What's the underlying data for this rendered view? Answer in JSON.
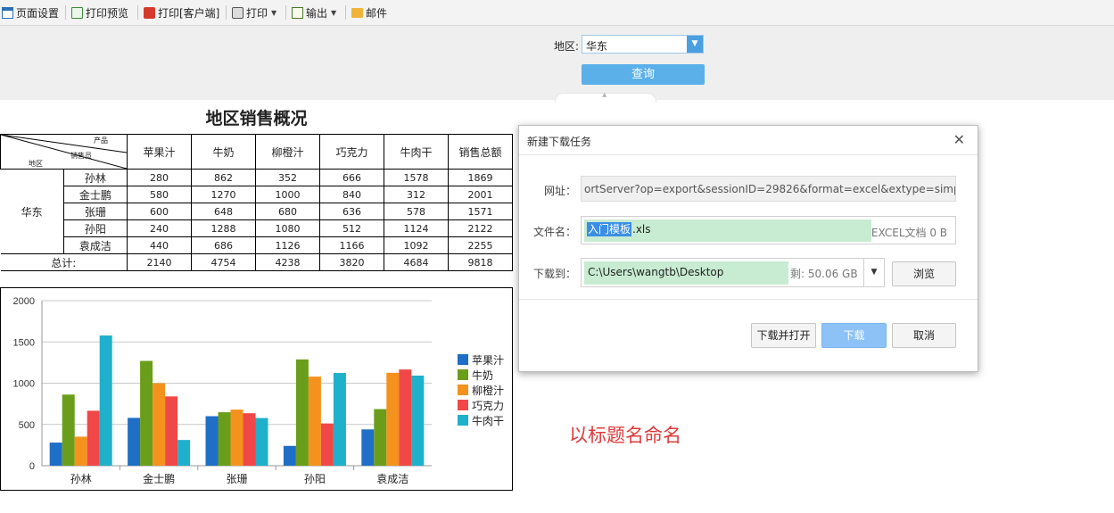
{
  "toolbar": {
    "page_setup": "页面设置",
    "print_preview": "打印预览",
    "print_client": "打印[客户端]",
    "print": "打印",
    "export": "输出",
    "mail": "邮件"
  },
  "params": {
    "region_label": "地区:",
    "region_value": "华东",
    "query_button": "查询"
  },
  "report": {
    "title": "地区销售概况",
    "header_diag": {
      "product": "产品",
      "salesperson": "销售员",
      "region": "地区"
    },
    "columns": [
      "苹果汁",
      "牛奶",
      "柳橙汁",
      "巧克力",
      "牛肉干",
      "销售总额"
    ],
    "region": "华东",
    "rows": [
      {
        "name": "孙林",
        "values": [
          "280",
          "862",
          "352",
          "666",
          "1578",
          "1869"
        ]
      },
      {
        "name": "金士鹏",
        "values": [
          "580",
          "1270",
          "1000",
          "840",
          "312",
          "2001"
        ]
      },
      {
        "name": "张珊",
        "values": [
          "600",
          "648",
          "680",
          "636",
          "578",
          "1571"
        ]
      },
      {
        "name": "孙阳",
        "values": [
          "240",
          "1288",
          "1080",
          "512",
          "1124",
          "2122"
        ]
      },
      {
        "name": "袁成洁",
        "values": [
          "440",
          "686",
          "1126",
          "1166",
          "1092",
          "2255"
        ]
      }
    ],
    "total_label": "总计:",
    "totals": [
      "2140",
      "4754",
      "4238",
      "3820",
      "4684",
      "9818"
    ]
  },
  "chart_data": {
    "type": "bar",
    "categories": [
      "孙林",
      "金士鹏",
      "张珊",
      "孙阳",
      "袁成洁"
    ],
    "series": [
      {
        "name": "苹果汁",
        "color": "#1f6fc6",
        "values": [
          280,
          580,
          600,
          240,
          440
        ]
      },
      {
        "name": "牛奶",
        "color": "#6a9e1a",
        "values": [
          862,
          1270,
          648,
          1288,
          686
        ]
      },
      {
        "name": "柳橙汁",
        "color": "#f5921e",
        "values": [
          352,
          1000,
          680,
          1080,
          1126
        ]
      },
      {
        "name": "巧克力",
        "color": "#f04848",
        "values": [
          666,
          840,
          636,
          512,
          1166
        ]
      },
      {
        "name": "牛肉干",
        "color": "#1fb0cc",
        "values": [
          1578,
          312,
          578,
          1124,
          1092
        ]
      }
    ],
    "ylim": [
      0,
      2000
    ],
    "yticks": [
      "0",
      "500",
      "1000",
      "1500",
      "2000"
    ],
    "grid": true,
    "legend": "right"
  },
  "dialog": {
    "title": "新建下载任务",
    "url_label": "网址：",
    "url_value": "ortServer?op=export&sessionID=29826&format=excel&extype=simple",
    "filename_label": "文件名：",
    "filename_selected": "入门模板",
    "filename_ext": ".xls",
    "filetype": "EXCEL文档 0 B",
    "saveto_label": "下载到：",
    "saveto_path": "C:\\Users\\wangtb\\Desktop",
    "free_space": "剩: 50.06 GB",
    "browse_button": "浏览",
    "download_open_button": "下载并打开",
    "download_button": "下载",
    "cancel_button": "取消"
  },
  "annotation": "以标题名命名"
}
